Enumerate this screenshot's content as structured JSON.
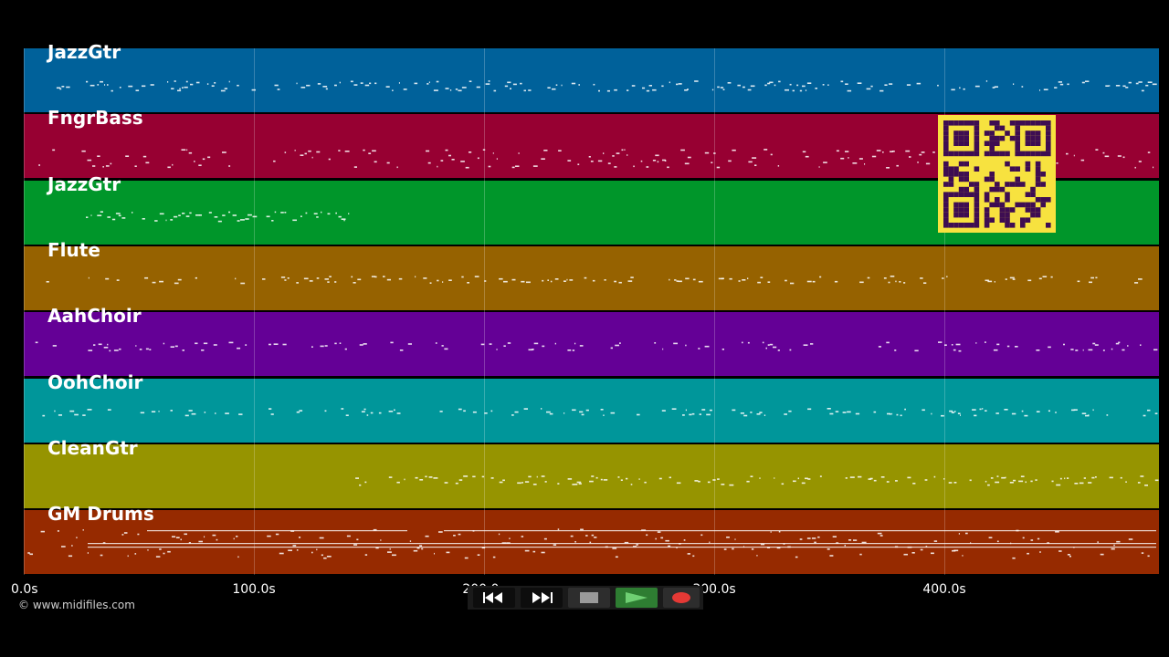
{
  "tracks": [
    {
      "name": "JazzGtr",
      "color": "#00619a"
    },
    {
      "name": "FngrBass",
      "color": "#970032"
    },
    {
      "name": "JazzGtr",
      "color": "#00962a"
    },
    {
      "name": "Flute",
      "color": "#966200"
    },
    {
      "name": "AahChoir",
      "color": "#640096"
    },
    {
      "name": "OohChoir",
      "color": "#00969a"
    },
    {
      "name": "CleanGtr",
      "color": "#969400"
    },
    {
      "name": "GM Drums",
      "color": "#962a00"
    }
  ],
  "timeline": {
    "seconds_per_tick": 100,
    "ticks": [
      "0.0s",
      "100.0s",
      "200.0s",
      "300.0s",
      "400.0s"
    ]
  },
  "copyright": "© www.midifiles.com",
  "qr_code": {
    "color": "#3e0d52",
    "background": "#f7e23f"
  },
  "transport": {
    "rewind": "rewind-icon",
    "fast_forward": "fast-forward-icon",
    "stop": "stop-icon",
    "play": "play-icon",
    "record": "record-icon",
    "play_color": "#2e7d32",
    "record_color": "#e53935"
  }
}
